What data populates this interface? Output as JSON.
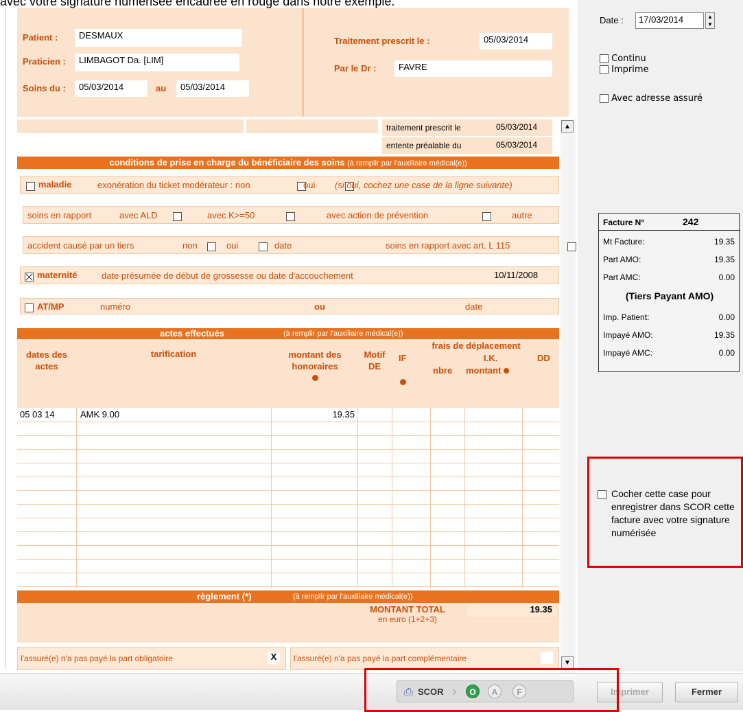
{
  "top_banner": "avec votre signature numérisée encadrée en rouge dans notre exemple.",
  "header": {
    "patient_label": "Patient :",
    "patient_value": "DESMAUX",
    "praticien_label": "Praticien :",
    "praticien_value": "LIMBAGOT Da. [LIM]",
    "soins_label": "Soins du :",
    "soins_from": "05/03/2014",
    "au_label": "au",
    "soins_to": "05/03/2014",
    "traitement_label": "Traitement prescrit le :",
    "traitement_value": "05/03/2014",
    "dr_label": "Par le Dr :",
    "dr_value": "FAVRE"
  },
  "prescription": {
    "traitement_label": "traitement prescrit le",
    "traitement_value": "05/03/2014",
    "entente_label": "entente préalable du",
    "entente_value": "05/03/2014"
  },
  "conditions": {
    "title": "conditions de prise en charge du bénéficiaire des soins",
    "subtitle": "(à remplir par l'auxiliaire médical(e))",
    "maladie": "maladie",
    "exoneration": "exonération du ticket modérateur : non",
    "oui": "oui",
    "si_oui": "(si oui, cochez une case de la ligne suivante)",
    "soins_rapport": "soins en rapport",
    "avec_ald": "avec ALD",
    "avec_k": "avec K>=50",
    "avec_prevention": "avec action de prévention",
    "autre": "autre",
    "accident": "accident causé par un tiers",
    "non": "non",
    "date": "date",
    "art_l115": "soins en rapport avec art. L 115",
    "maternite": "maternité",
    "maternite_desc": "date présumée de début de grossesse ou date d'accouchement",
    "maternite_date": "10/11/2008",
    "atmp": "AT/MP",
    "numero": "numéro",
    "ou": "ou"
  },
  "actes": {
    "title": "actes effectués",
    "subtitle": "(à remplir par l'auxiliaire médical(e))",
    "col_dates": "dates des actes",
    "col_tarif": "tarification",
    "col_montant": "montant des honoraires",
    "col_motif": "Motif DE",
    "col_frais": "frais de déplacement",
    "col_if": "IF",
    "col_ik": "I.K.",
    "col_dd": "DD",
    "col_nbre": "nbre",
    "col_montant_ik": "montant",
    "rows": [
      {
        "date": "05 03 14",
        "tarif": "AMK 9.00",
        "montant": "19.35"
      }
    ]
  },
  "reglement": {
    "title": "règlement (*)",
    "subtitle": "(à remplir par l'auxiliaire médical(e))",
    "total_label": "MONTANT TOTAL",
    "total_sub": "en euro (1+2+3)",
    "total_value": "19.35",
    "part_oblig": "l'assuré(e) n'a pas payé la part obligatoire",
    "part_oblig_mark": "X",
    "part_comp": "l'assuré(e) n'a pas payé la part complémentaire"
  },
  "side": {
    "date_label": "Date :",
    "date_value": "17/03/2014",
    "continu": "Continu",
    "imprime": "Imprime",
    "adresse": "Avec adresse assuré"
  },
  "facture": {
    "label": "Facture N°",
    "number": "242",
    "rows1": [
      {
        "label": "Mt Facture:",
        "value": "19.35"
      },
      {
        "label": "Part AMO:",
        "value": "19.35"
      },
      {
        "label": "Part AMC:",
        "value": "0.00"
      }
    ],
    "tiers": "(Tiers Payant AMO)",
    "rows2": [
      {
        "label": "Imp. Patient:",
        "value": "0.00"
      },
      {
        "label": "Impayé AMO:",
        "value": "19.35"
      },
      {
        "label": "Impayé AMC:",
        "value": "0.00"
      }
    ]
  },
  "scor_box": {
    "text": "Cocher cette case pour enregistrer dans SCOR cette facture avec votre signature numérisée"
  },
  "footer": {
    "scor": "SCOR",
    "o": "O",
    "a": "A",
    "f": "F",
    "imprimer": "Imprimer",
    "fermer": "Fermer"
  },
  "colors": {
    "accent": "#e8721e",
    "highlight": "#e00000"
  }
}
